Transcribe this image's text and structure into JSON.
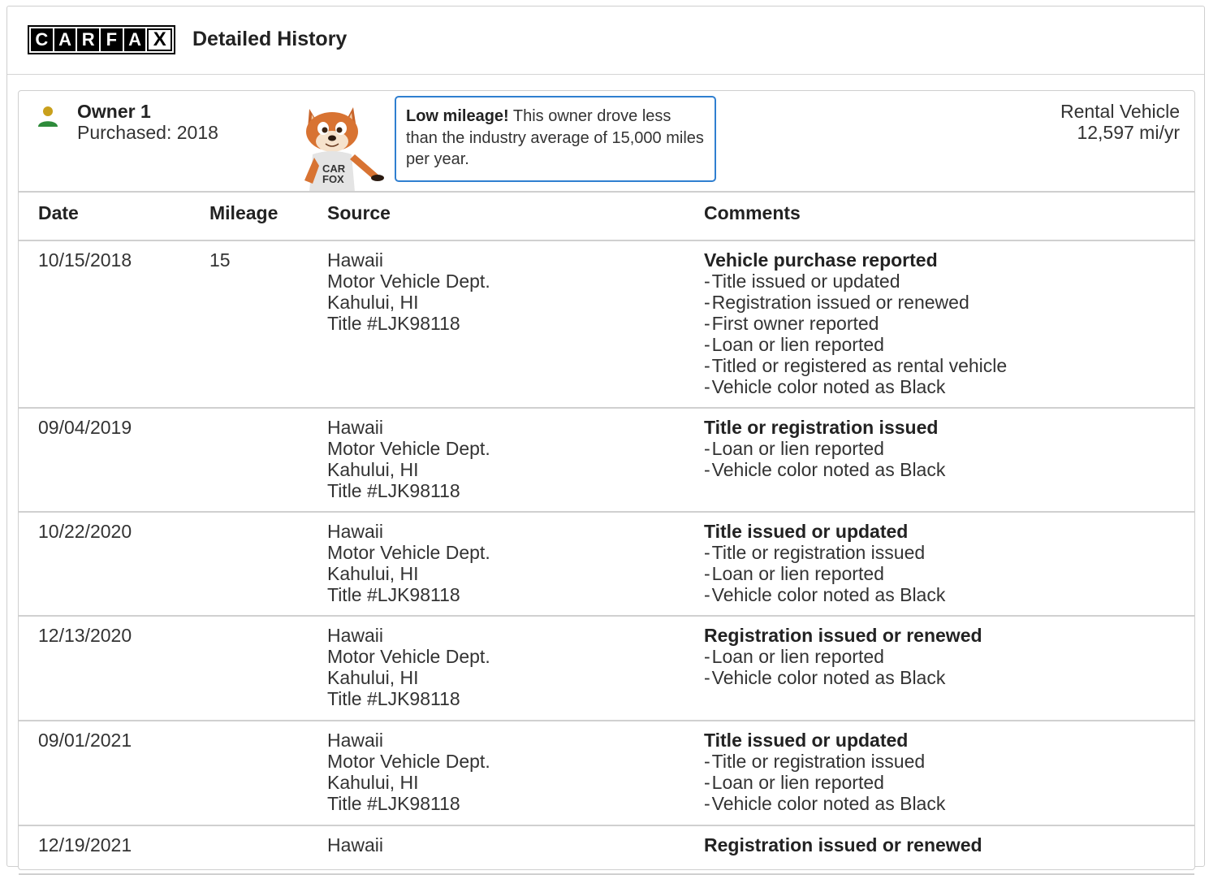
{
  "header": {
    "logo_letters": [
      "C",
      "A",
      "R",
      "F",
      "A",
      "X"
    ],
    "title": "Detailed History"
  },
  "owner": {
    "name": "Owner 1",
    "purchased": "Purchased: 2018",
    "callout_bold": "Low mileage!",
    "callout_text": " This owner drove less than the industry average of 15,000 miles per year.",
    "usage_type": "Rental Vehicle",
    "usage_miles": "12,597 mi/yr",
    "icon_color_head": "#c9a01c",
    "icon_color_body": "#2e8b3a"
  },
  "table": {
    "columns": [
      "Date",
      "Mileage",
      "Source",
      "Comments"
    ],
    "rows": [
      {
        "date": "10/15/2018",
        "mileage": "15",
        "source": [
          "Hawaii",
          "Motor Vehicle Dept.",
          "Kahului, HI",
          "Title #LJK98118"
        ],
        "comment_title": "Vehicle purchase reported",
        "comments": [
          "Title issued or updated",
          "Registration issued or renewed",
          "First owner reported",
          "Loan or lien reported",
          "Titled or registered as rental vehicle",
          "Vehicle color noted as Black"
        ]
      },
      {
        "date": "09/04/2019",
        "mileage": "",
        "source": [
          "Hawaii",
          "Motor Vehicle Dept.",
          "Kahului, HI",
          "Title #LJK98118"
        ],
        "comment_title": "Title or registration issued",
        "comments": [
          "Loan or lien reported",
          "Vehicle color noted as Black"
        ]
      },
      {
        "date": "10/22/2020",
        "mileage": "",
        "source": [
          "Hawaii",
          "Motor Vehicle Dept.",
          "Kahului, HI",
          "Title #LJK98118"
        ],
        "comment_title": "Title issued or updated",
        "comments": [
          "Title or registration issued",
          "Loan or lien reported",
          "Vehicle color noted as Black"
        ]
      },
      {
        "date": "12/13/2020",
        "mileage": "",
        "source": [
          "Hawaii",
          "Motor Vehicle Dept.",
          "Kahului, HI",
          "Title #LJK98118"
        ],
        "comment_title": "Registration issued or renewed",
        "comments": [
          "Loan or lien reported",
          "Vehicle color noted as Black"
        ]
      },
      {
        "date": "09/01/2021",
        "mileage": "",
        "source": [
          "Hawaii",
          "Motor Vehicle Dept.",
          "Kahului, HI",
          "Title #LJK98118"
        ],
        "comment_title": "Title issued or updated",
        "comments": [
          "Title or registration issued",
          "Loan or lien reported",
          "Vehicle color noted as Black"
        ]
      },
      {
        "date": "12/19/2021",
        "mileage": "",
        "source": [
          "Hawaii"
        ],
        "comment_title": "Registration issued or renewed",
        "comments": []
      }
    ]
  }
}
